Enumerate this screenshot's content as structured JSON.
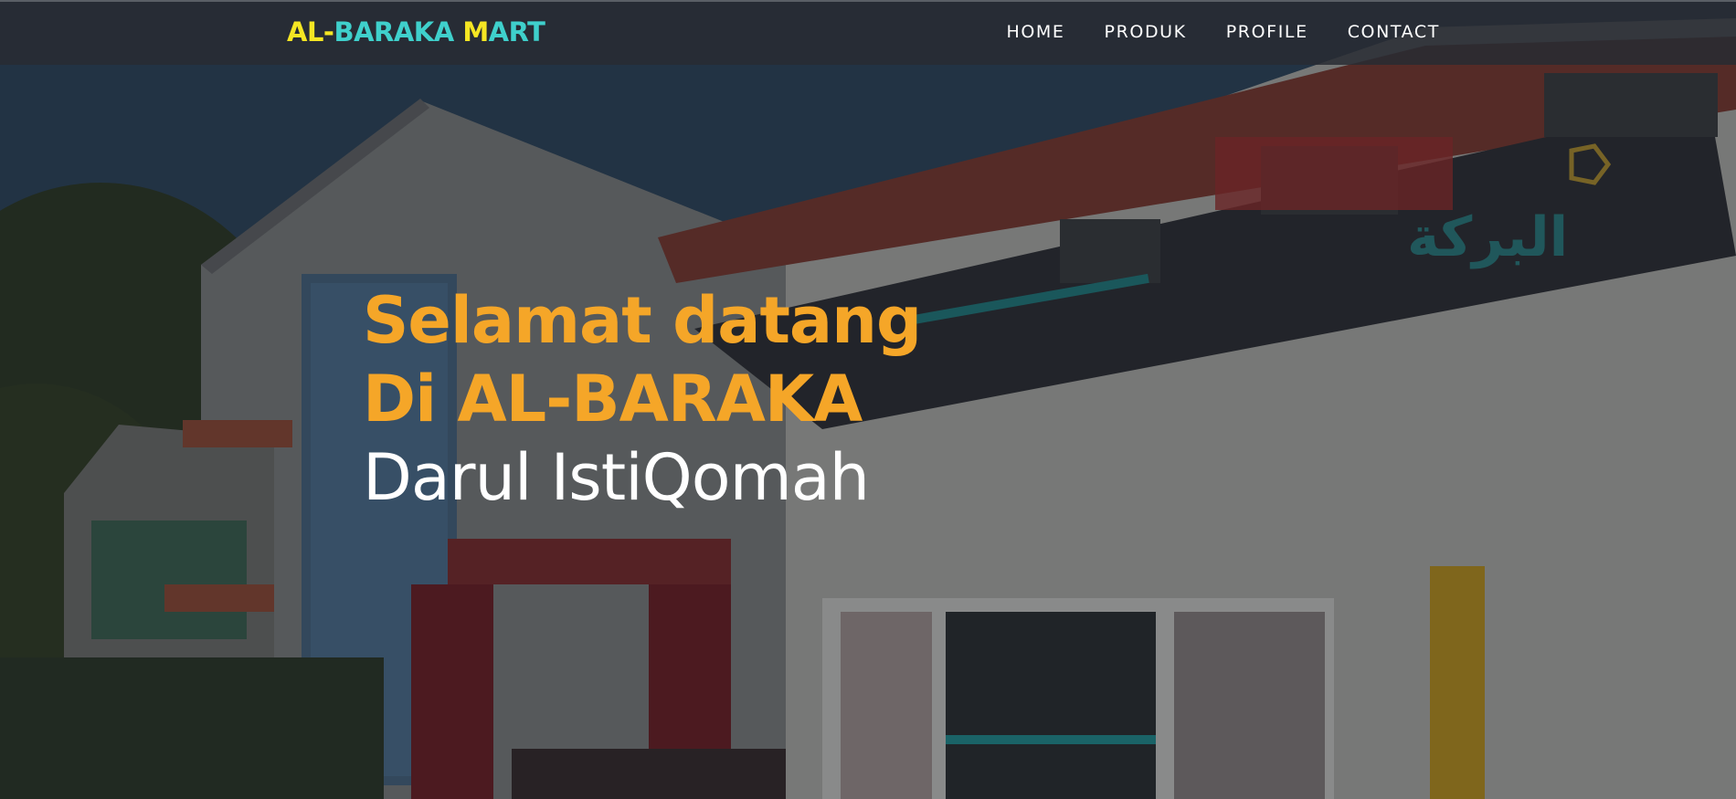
{
  "brand": {
    "part1": "AL-",
    "part2": "BARAKA ",
    "part3": "M",
    "part4": "ART",
    "colors": {
      "yellow": "#f5e623",
      "cyan": "#3fd0cc"
    }
  },
  "nav": {
    "home": "HOME",
    "produk": "PRODUK",
    "profile": "PROFILE",
    "contact": "CONTACT"
  },
  "hero": {
    "line1": "Selamat datang",
    "line2": "Di AL-BARAKA",
    "line3": "Darul IstiQomah",
    "accent_color": "#f5a628",
    "background_image": "store-building-photo"
  }
}
